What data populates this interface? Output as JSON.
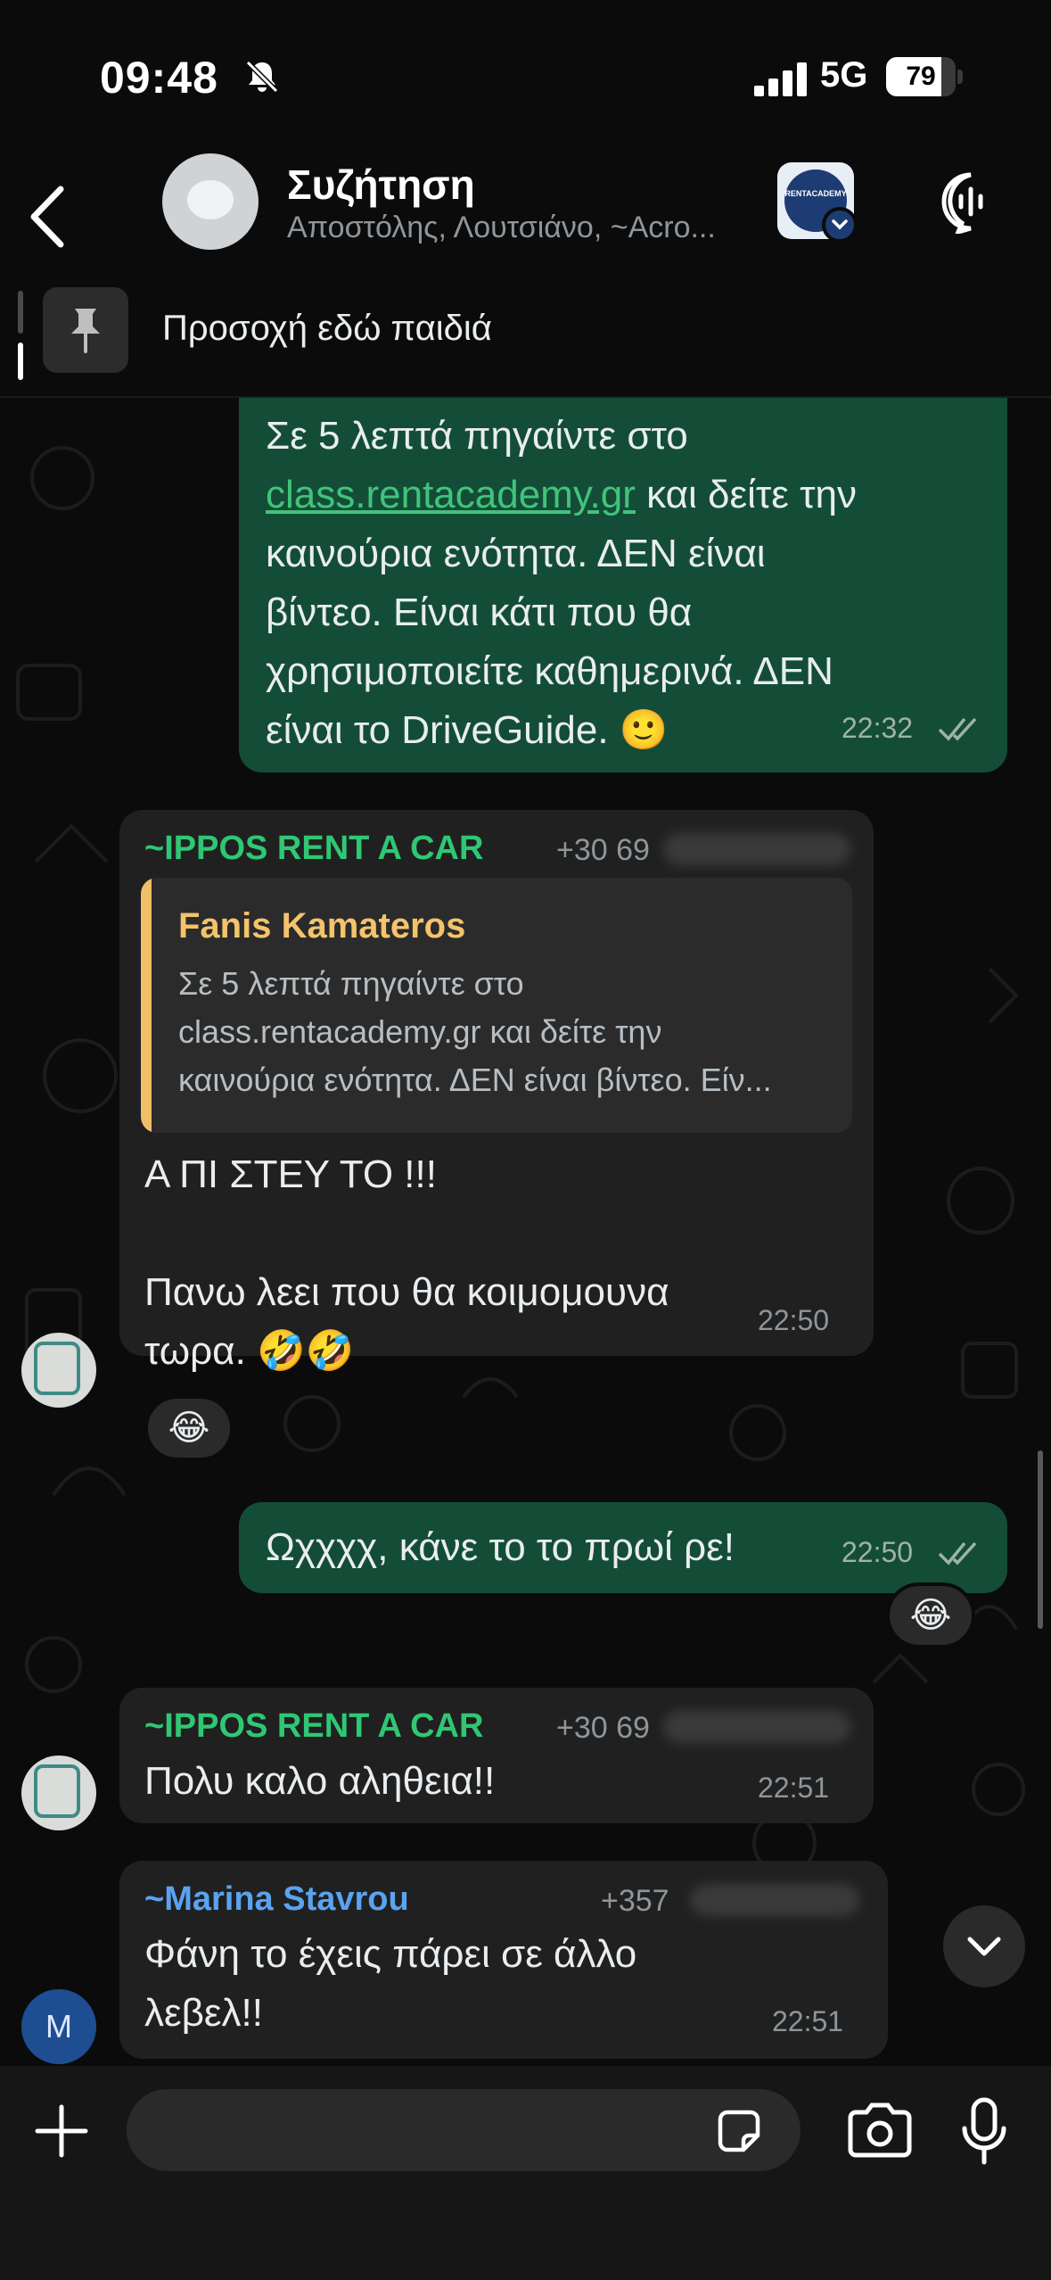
{
  "status": {
    "time": "09:48",
    "network": "5G",
    "battery": "79",
    "battery_level": 0.79
  },
  "header": {
    "title": "Συζήτηση",
    "subtitle": "Αποστόλης, Λουτσιάνο, ~Acro...",
    "logo_text": "RENTACADEMY"
  },
  "pinned": {
    "text": "Προσοχή εδώ παιδιά"
  },
  "messages": {
    "m1": {
      "line1": "Σε 5 λεπτά πηγαίντε στο",
      "link": "class.rentacademy.gr",
      "line2_rest": " και δείτε την",
      "line3": "καινούρια ενότητα. ΔΕΝ είναι",
      "line4": "βίντεο. Είναι κάτι που θα",
      "line5": "χρησιμοποιείτε καθημερινά. ΔΕΝ",
      "line6": "είναι το DriveGuide. 🙂",
      "time": "22:32"
    },
    "m2": {
      "sender": "~IPPOS RENT A CAR",
      "phone": "+30 69",
      "reply_name": "Fanis Kamateros",
      "reply_line1": "Σε 5 λεπτά πηγαίντε στο",
      "reply_line2": "class.rentacademy.gr και δείτε την",
      "reply_line3": "καινούρια ενότητα. ΔΕΝ είναι βίντεο. Είν...",
      "line1": "Α ΠΙ ΣΤΕΥ ΤΟ !!!",
      "line2": "Πανω λεει που θα κοιμομουνα",
      "line3": "τωρα. 🤣🤣",
      "time": "22:50",
      "reaction": "😂"
    },
    "m3": {
      "text": "Ωχχχχ, κάνε το το πρωί ρε!",
      "time": "22:50",
      "reaction": "😂"
    },
    "m4": {
      "sender": "~IPPOS RENT A CAR",
      "phone": "+30 69",
      "text": "Πολυ καλο αληθεια!!",
      "time": "22:51"
    },
    "m5": {
      "sender": "~Marina Stavrou",
      "phone": "+357",
      "line1": "Φάνη το έχεις πάρει σε άλλο",
      "line2": "λεβελ!!",
      "time": "22:51",
      "avatar_letter": "M"
    }
  },
  "composer": {
    "placeholder": ""
  },
  "colors": {
    "outgoing_bubble": "#144d37",
    "incoming_bubble": "#202020",
    "link": "#40c47a",
    "ippos_sender": "#2fc774",
    "marina_sender": "#5aa3f0",
    "reply_name": "#f4c36b"
  },
  "icons": [
    "back-chevron-icon",
    "bell-off-icon",
    "signal-icon",
    "voice-chat-icon",
    "pin-icon",
    "double-check-icon",
    "chevron-down-icon",
    "plus-icon",
    "sticker-icon",
    "camera-icon",
    "mic-icon"
  ]
}
